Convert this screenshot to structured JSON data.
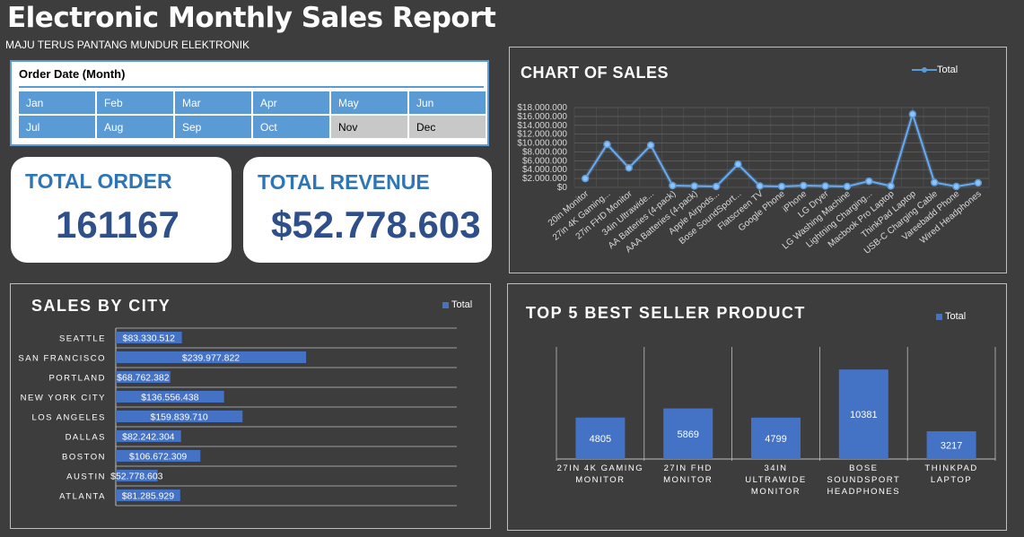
{
  "header": {
    "title": "Electronic Monthly Sales Report",
    "subtitle": "MAJU TERUS PANTANG MUNDUR ELEKTRONIK"
  },
  "slicer": {
    "title": "Order Date (Month)",
    "months": [
      {
        "label": "Jan",
        "selected": true
      },
      {
        "label": "Feb",
        "selected": true
      },
      {
        "label": "Mar",
        "selected": true
      },
      {
        "label": "Apr",
        "selected": true
      },
      {
        "label": "May",
        "selected": true
      },
      {
        "label": "Jun",
        "selected": true
      },
      {
        "label": "Jul",
        "selected": true
      },
      {
        "label": "Aug",
        "selected": true
      },
      {
        "label": "Sep",
        "selected": true
      },
      {
        "label": "Oct",
        "selected": true
      },
      {
        "label": "Nov",
        "selected": false
      },
      {
        "label": "Dec",
        "selected": false
      }
    ]
  },
  "kpi": {
    "order_label": "TOTAL ORDER",
    "order_value": "161167",
    "revenue_label": "TOTAL REVENUE",
    "revenue_value": "$52.778.603"
  },
  "colors": {
    "accent": "#4472c4",
    "line": "#5b9bd5",
    "background": "#3d3d3d",
    "slicer_selected": "#5b9bd5",
    "slicer_unselected": "#c8c8c8"
  },
  "chart_data": [
    {
      "type": "line",
      "title": "CHART OF SALES",
      "legend": "Total",
      "legend_position": "top-right",
      "grid": true,
      "ylim": [
        0,
        18000000
      ],
      "y_ticks": [
        "$0",
        "$2.000.000",
        "$4.000.000",
        "$6.000.000",
        "$8.000.000",
        "$10.000.000",
        "$12.000.000",
        "$14.000.000",
        "$16.000.000",
        "$18.000.000"
      ],
      "categories": [
        "20in Monitor",
        "27in 4K Gaming...",
        "27in FHD Monitor",
        "34in Ultrawide...",
        "AA Batteries (4-pack)",
        "AAA Batteries (4-pack)",
        "Apple Airpods...",
        "Bose SoundSport...",
        "Flatscreen TV",
        "Google Phone",
        "iPhone",
        "LG Dryer",
        "LG Washing Machine",
        "Lightning Charging...",
        "Macbook Pro Laptop",
        "ThinkPad Laptop",
        "USB-C Charging Cable",
        "Vareebadd Phone",
        "Wired Headphones"
      ],
      "series": [
        {
          "name": "Total",
          "values": [
            2000000,
            9700000,
            4400000,
            9500000,
            400000,
            300000,
            200000,
            5200000,
            300000,
            200000,
            400000,
            300000,
            200000,
            1400000,
            300000,
            16500000,
            1100000,
            200000,
            1000000
          ]
        }
      ]
    },
    {
      "type": "bar",
      "orientation": "horizontal",
      "title": "SALES BY CITY",
      "legend": "Total",
      "legend_position": "top-right",
      "categories": [
        "SEATTLE",
        "SAN FRANCISCO",
        "PORTLAND",
        "NEW YORK CITY",
        "LOS ANGELES",
        "DALLAS",
        "BOSTON",
        "AUSTIN",
        "ATLANTA"
      ],
      "values": [
        83330512,
        239977822,
        68762382,
        136556438,
        159839710,
        82242304,
        106672309,
        52778603,
        81285929
      ],
      "labels": [
        "$83.330.512",
        "$239.977.822",
        "$68.762.382",
        "$136.556.438",
        "$159.839.710",
        "$82.242.304",
        "$106.672.309",
        "$52.778.603",
        "$81.285.929"
      ],
      "xlim": [
        0,
        430000000
      ]
    },
    {
      "type": "bar",
      "title": "TOP 5 BEST SELLER PRODUCT",
      "legend": "Total",
      "legend_position": "top-right",
      "categories": [
        "27IN 4K GAMING MONITOR",
        "27IN FHD MONITOR",
        "34IN ULTRAWIDE MONITOR",
        "BOSE SOUNDSPORT HEADPHONES",
        "THINKPAD LAPTOP"
      ],
      "category_lines": [
        [
          "27IN 4K GAMING",
          "MONITOR"
        ],
        [
          "27IN FHD",
          "MONITOR"
        ],
        [
          "34IN",
          "ULTRAWIDE",
          "MONITOR"
        ],
        [
          "BOSE",
          "SOUNDSPORT",
          "HEADPHONES"
        ],
        [
          "THINKPAD",
          "LAPTOP"
        ]
      ],
      "values": [
        4805,
        5869,
        4799,
        10381,
        3217
      ],
      "ylim": [
        0,
        13000
      ]
    }
  ]
}
